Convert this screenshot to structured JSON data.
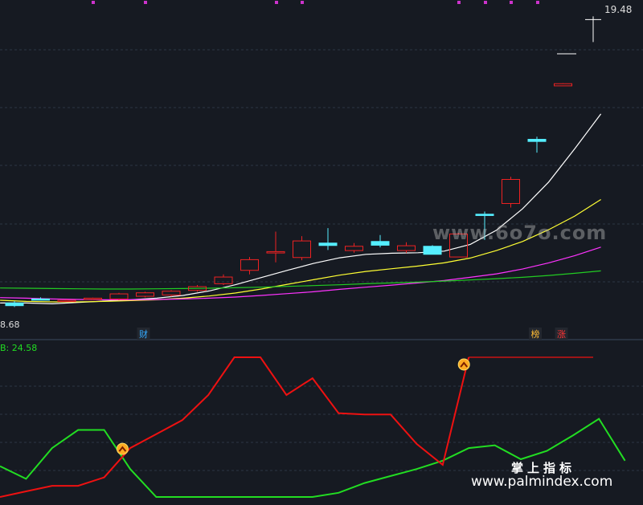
{
  "chart_data": [
    {
      "type": "candlestick",
      "price_high_label": "19.48",
      "price_low_label": "8.68",
      "ylim": [
        7.6,
        20
      ],
      "candles": [
        {
          "o": 8.88,
          "h": 8.95,
          "l": 8.73,
          "c": 8.78
        },
        {
          "o": 9.03,
          "h": 9.09,
          "l": 8.98,
          "c": 9.02
        },
        {
          "o": 8.95,
          "h": 9.01,
          "l": 8.92,
          "c": 8.98
        },
        {
          "o": 9.01,
          "h": 9.08,
          "l": 8.98,
          "c": 9.06
        },
        {
          "o": 9.03,
          "h": 9.26,
          "l": 8.99,
          "c": 9.22
        },
        {
          "o": 9.13,
          "h": 9.3,
          "l": 9.09,
          "c": 9.26
        },
        {
          "o": 9.18,
          "h": 9.36,
          "l": 9.12,
          "c": 9.32
        },
        {
          "o": 9.35,
          "h": 9.55,
          "l": 9.3,
          "c": 9.49
        },
        {
          "o": 9.6,
          "h": 9.95,
          "l": 9.55,
          "c": 9.85
        },
        {
          "o": 10.1,
          "h": 10.6,
          "l": 9.95,
          "c": 10.5
        },
        {
          "o": 10.75,
          "h": 11.55,
          "l": 10.4,
          "c": 10.8
        },
        {
          "o": 10.58,
          "h": 11.38,
          "l": 10.48,
          "c": 11.2
        },
        {
          "o": 11.12,
          "h": 11.68,
          "l": 10.86,
          "c": 11.03
        },
        {
          "o": 10.84,
          "h": 11.12,
          "l": 10.76,
          "c": 11.0
        },
        {
          "o": 11.18,
          "h": 11.42,
          "l": 10.96,
          "c": 11.04
        },
        {
          "o": 10.84,
          "h": 11.15,
          "l": 10.75,
          "c": 11.02
        },
        {
          "o": 11.0,
          "h": 11.04,
          "l": 10.7,
          "c": 10.7
        },
        {
          "o": 10.6,
          "h": 11.5,
          "l": 10.6,
          "c": 11.46
        },
        {
          "o": 12.2,
          "h": 12.3,
          "l": 11.24,
          "c": 12.15
        },
        {
          "o": 12.6,
          "h": 13.6,
          "l": 12.45,
          "c": 13.5
        },
        {
          "o": 15.0,
          "h": 15.1,
          "l": 14.5,
          "c": 14.92
        },
        {
          "o": 17.0,
          "h": 17.1,
          "l": 17.0,
          "c": 17.08
        }
      ],
      "ma_series": [
        {
          "color": "#ffffff",
          "values": [
            8.88,
            8.88,
            8.85,
            8.9,
            8.95,
            9.0,
            9.06,
            9.16,
            9.33,
            9.56,
            9.83,
            10.1,
            10.36,
            10.57,
            10.7,
            10.74,
            10.76,
            10.82,
            11.07,
            11.6,
            12.4,
            13.4,
            14.65,
            15.95
          ]
        },
        {
          "color": "#ffff33",
          "values": [
            8.98,
            8.94,
            8.92,
            8.92,
            8.94,
            8.97,
            9.0,
            9.06,
            9.14,
            9.25,
            9.4,
            9.58,
            9.75,
            9.92,
            10.06,
            10.16,
            10.26,
            10.38,
            10.56,
            10.84,
            11.18,
            11.62,
            12.13,
            12.75
          ]
        },
        {
          "color": "#ff33ff",
          "values": [
            9.08,
            9.06,
            9.03,
            9.01,
            9.0,
            9.0,
            9.01,
            9.03,
            9.06,
            9.1,
            9.16,
            9.23,
            9.3,
            9.39,
            9.47,
            9.55,
            9.63,
            9.72,
            9.84,
            9.97,
            10.15,
            10.38,
            10.65,
            10.97
          ]
        },
        {
          "color": "#22cc22",
          "values": [
            9.44,
            9.43,
            9.42,
            9.41,
            9.4,
            9.4,
            9.41,
            9.42,
            9.43,
            9.45,
            9.47,
            9.5,
            9.53,
            9.56,
            9.6,
            9.63,
            9.66,
            9.7,
            9.74,
            9.79,
            9.84,
            9.91,
            9.99,
            10.08
          ]
        }
      ],
      "tags": [
        {
          "index": 5,
          "text": "财",
          "color": "#33aaff"
        },
        {
          "index": 20,
          "text": "榜",
          "color": "#ffbb33"
        },
        {
          "index": 21,
          "text": "涨",
          "color": "#ff3333"
        }
      ]
    },
    {
      "type": "line",
      "label": "B: 24.58",
      "ylim": [
        0,
        100
      ],
      "values": [
        22,
        13,
        35,
        48,
        48,
        20,
        0,
        0,
        0,
        0,
        0,
        0,
        0,
        3,
        10,
        15,
        20,
        26,
        35,
        37,
        27,
        33,
        44,
        56,
        26
      ],
      "break_up_at": 6,
      "break_down_at": 18,
      "flat_after": 18,
      "flat_value": 100,
      "colors": {
        "up": "#ee1111",
        "down": "#22dd22"
      },
      "red_values": [
        0,
        4,
        8,
        8,
        14,
        35,
        45,
        55,
        73,
        100,
        100,
        73,
        85,
        60,
        59,
        59,
        38,
        23,
        100
      ]
    }
  ],
  "watermarks": {
    "mid": "www.6o7o.com",
    "brand": "掌上指标",
    "url": "www.palmindex.com"
  }
}
